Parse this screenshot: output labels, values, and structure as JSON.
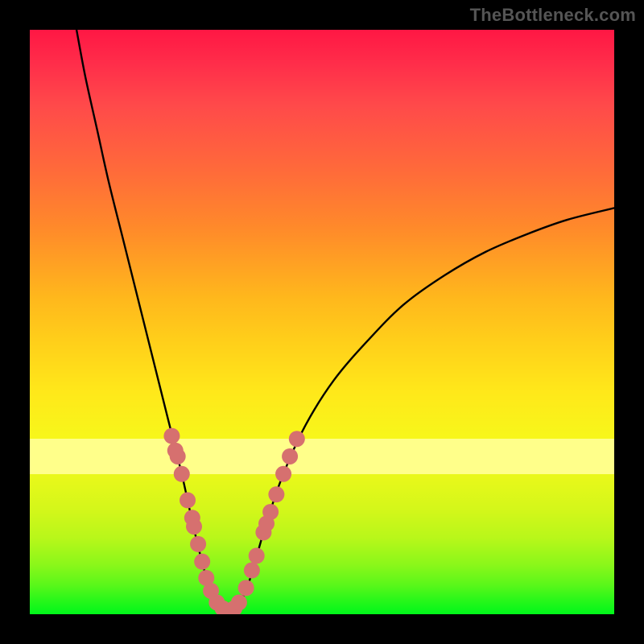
{
  "watermark": {
    "text": "TheBottleneck.com"
  },
  "colors": {
    "dot": "#d6706f",
    "curve": "#000000",
    "legal_band": "#ffff8a"
  },
  "chart_data": {
    "type": "line",
    "title": "",
    "xlabel": "",
    "ylabel": "",
    "xlim": [
      0,
      100
    ],
    "ylim": [
      0,
      100
    ],
    "legal_band_y": [
      24,
      30
    ],
    "curve_points": [
      {
        "x": 8.0,
        "y": 100.0
      },
      {
        "x": 9.5,
        "y": 92.0
      },
      {
        "x": 11.5,
        "y": 83.0
      },
      {
        "x": 13.5,
        "y": 74.0
      },
      {
        "x": 16.0,
        "y": 64.0
      },
      {
        "x": 18.5,
        "y": 54.0
      },
      {
        "x": 21.0,
        "y": 44.0
      },
      {
        "x": 23.5,
        "y": 34.0
      },
      {
        "x": 26.0,
        "y": 24.0
      },
      {
        "x": 28.0,
        "y": 15.0
      },
      {
        "x": 30.0,
        "y": 7.0
      },
      {
        "x": 31.5,
        "y": 3.0
      },
      {
        "x": 33.0,
        "y": 1.0
      },
      {
        "x": 34.0,
        "y": 0.4
      },
      {
        "x": 35.0,
        "y": 1.0
      },
      {
        "x": 36.5,
        "y": 3.0
      },
      {
        "x": 38.0,
        "y": 7.0
      },
      {
        "x": 40.0,
        "y": 14.0
      },
      {
        "x": 43.0,
        "y": 23.0
      },
      {
        "x": 47.0,
        "y": 32.0
      },
      {
        "x": 52.0,
        "y": 40.0
      },
      {
        "x": 58.0,
        "y": 47.0
      },
      {
        "x": 64.0,
        "y": 53.0
      },
      {
        "x": 71.0,
        "y": 58.0
      },
      {
        "x": 78.0,
        "y": 62.0
      },
      {
        "x": 85.0,
        "y": 65.0
      },
      {
        "x": 92.0,
        "y": 67.5
      },
      {
        "x": 100.0,
        "y": 69.5
      }
    ],
    "dots": [
      {
        "x": 24.3,
        "y": 30.5
      },
      {
        "x": 24.9,
        "y": 28.0
      },
      {
        "x": 25.3,
        "y": 27.0
      },
      {
        "x": 26.0,
        "y": 24.0
      },
      {
        "x": 27.0,
        "y": 19.5
      },
      {
        "x": 27.8,
        "y": 16.5
      },
      {
        "x": 28.1,
        "y": 15.0
      },
      {
        "x": 28.8,
        "y": 12.0
      },
      {
        "x": 29.5,
        "y": 9.0
      },
      {
        "x": 30.2,
        "y": 6.2
      },
      {
        "x": 31.0,
        "y": 4.0
      },
      {
        "x": 32.0,
        "y": 2.0
      },
      {
        "x": 33.0,
        "y": 1.0
      },
      {
        "x": 34.0,
        "y": 0.6
      },
      {
        "x": 35.0,
        "y": 1.0
      },
      {
        "x": 35.8,
        "y": 2.0
      },
      {
        "x": 37.0,
        "y": 4.5
      },
      {
        "x": 38.0,
        "y": 7.5
      },
      {
        "x": 38.8,
        "y": 10.0
      },
      {
        "x": 40.0,
        "y": 14.0
      },
      {
        "x": 40.5,
        "y": 15.5
      },
      {
        "x": 41.2,
        "y": 17.5
      },
      {
        "x": 42.2,
        "y": 20.5
      },
      {
        "x": 43.4,
        "y": 24.0
      },
      {
        "x": 44.5,
        "y": 27.0
      },
      {
        "x": 45.7,
        "y": 30.0
      }
    ],
    "dot_radius_px": 10
  }
}
